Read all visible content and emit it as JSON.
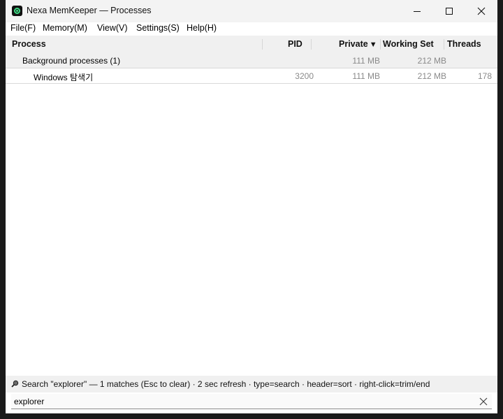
{
  "window": {
    "title": "Nexa MemKeeper — Processes",
    "controls": [
      "minimize",
      "maximize",
      "close"
    ]
  },
  "menu": [
    "File(F)",
    "Memory(M)",
    "View(V)",
    "Settings(S)",
    "Help(H)"
  ],
  "columns": {
    "process": "Process",
    "pid": "PID",
    "private": "Private",
    "private_sort_indicator": "▼",
    "working_set": "Working Set",
    "threads": "Threads"
  },
  "groups": [
    {
      "label": "Background processes (1)",
      "private": "111 MB",
      "working_set": "212 MB",
      "processes": [
        {
          "name": "Windows 탐색기",
          "pid": "3200",
          "private": "111 MB",
          "working_set": "212 MB",
          "threads": "178"
        }
      ]
    }
  ],
  "status": {
    "text": "Search \"explorer\" — 1 matches (Esc to clear) · 2 sec refresh · type=search · header=sort · right-click=trim/end",
    "icon": "magnifier-icon"
  },
  "search": {
    "value": "explorer"
  },
  "colors": {
    "accent_icon": "#3ddc84",
    "header_bg": "#f0f0f0",
    "numeric_text": "#8a8a8a"
  }
}
